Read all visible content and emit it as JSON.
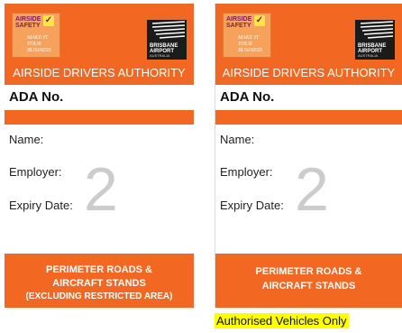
{
  "colors": {
    "orange": "#f26722",
    "highlight": "#ffff00",
    "numeral": "#cccccc"
  },
  "cards": [
    {
      "logo": {
        "line1": "AIRSIDE",
        "line2": "SAFETY",
        "tick_icon": "checkmark-icon",
        "slogan1": "MAKE IT",
        "slogan2": "YOUR",
        "slogan3": "BUSINESS"
      },
      "airport": {
        "line1": "BRISBANE",
        "line2": "AIRPORT",
        "line3": "AUSTRALIA"
      },
      "title": "AIRSIDE DRIVERS AUTHORITY",
      "ada_label": "ADA No.",
      "fields": {
        "name": "Name:",
        "employer": "Employer:",
        "expiry": "Expiry Date:"
      },
      "number": "2",
      "footer": {
        "line1": "PERIMETER ROADS &",
        "line2": "AIRCRAFT STANDS",
        "line3": "(EXCLUDING RESTRICTED AREA)"
      }
    },
    {
      "logo": {
        "line1": "AIRSIDE",
        "line2": "SAFETY",
        "tick_icon": "checkmark-icon",
        "slogan1": "MAKE IT",
        "slogan2": "YOUR",
        "slogan3": "BUSINESS"
      },
      "airport": {
        "line1": "BRISBANE",
        "line2": "AIRPORT",
        "line3": "AUSTRALIA"
      },
      "title": "AIRSIDE DRIVERS AUTHORITY",
      "ada_label": "ADA No.",
      "fields": {
        "name": "Name:",
        "employer": "Employer:",
        "expiry": "Expiry Date:"
      },
      "number": "2",
      "footer": {
        "line1": "PERIMETER ROADS &",
        "line2": "AIRCRAFT STANDS"
      }
    }
  ],
  "caption": "Authorised Vehicles Only"
}
